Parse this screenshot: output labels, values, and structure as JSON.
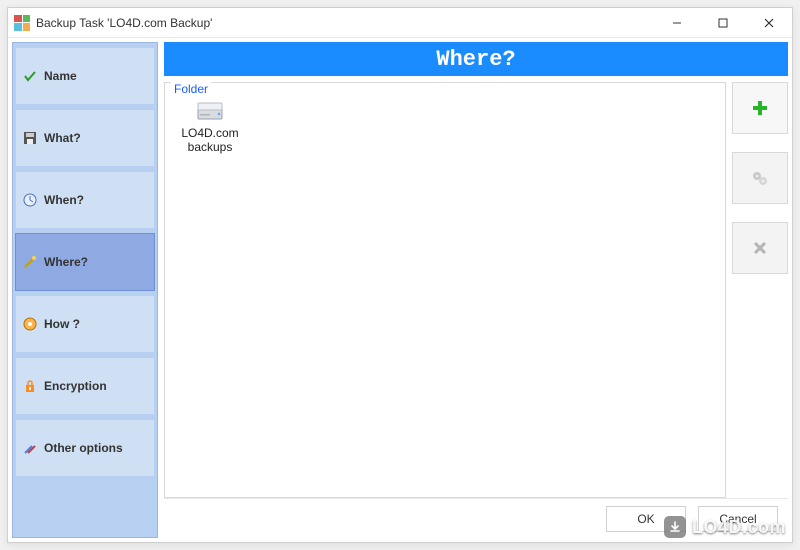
{
  "window": {
    "title": "Backup Task 'LO4D.com Backup'"
  },
  "sidebar": {
    "items": [
      {
        "label": "Name",
        "icon": "check-icon"
      },
      {
        "label": "What?",
        "icon": "floppy-icon"
      },
      {
        "label": "When?",
        "icon": "clock-icon"
      },
      {
        "label": "Where?",
        "icon": "wand-icon"
      },
      {
        "label": "How ?",
        "icon": "disc-icon"
      },
      {
        "label": "Encryption",
        "icon": "lock-icon"
      },
      {
        "label": "Other options",
        "icon": "tools-icon"
      }
    ],
    "active_index": 3
  },
  "header": {
    "title": "Where?"
  },
  "folder_panel": {
    "legend": "Folder",
    "items": [
      {
        "line1": "LO4D.com",
        "line2": "backups",
        "icon": "drive-icon"
      }
    ]
  },
  "actions": {
    "add": {
      "icon": "plus-icon",
      "enabled": true
    },
    "config": {
      "icon": "gear-icon",
      "enabled": false
    },
    "remove": {
      "icon": "close-icon",
      "enabled": false
    }
  },
  "footer": {
    "ok_label": "OK",
    "cancel_label": "Cancel"
  },
  "watermark": {
    "text": "LO4D.com"
  }
}
